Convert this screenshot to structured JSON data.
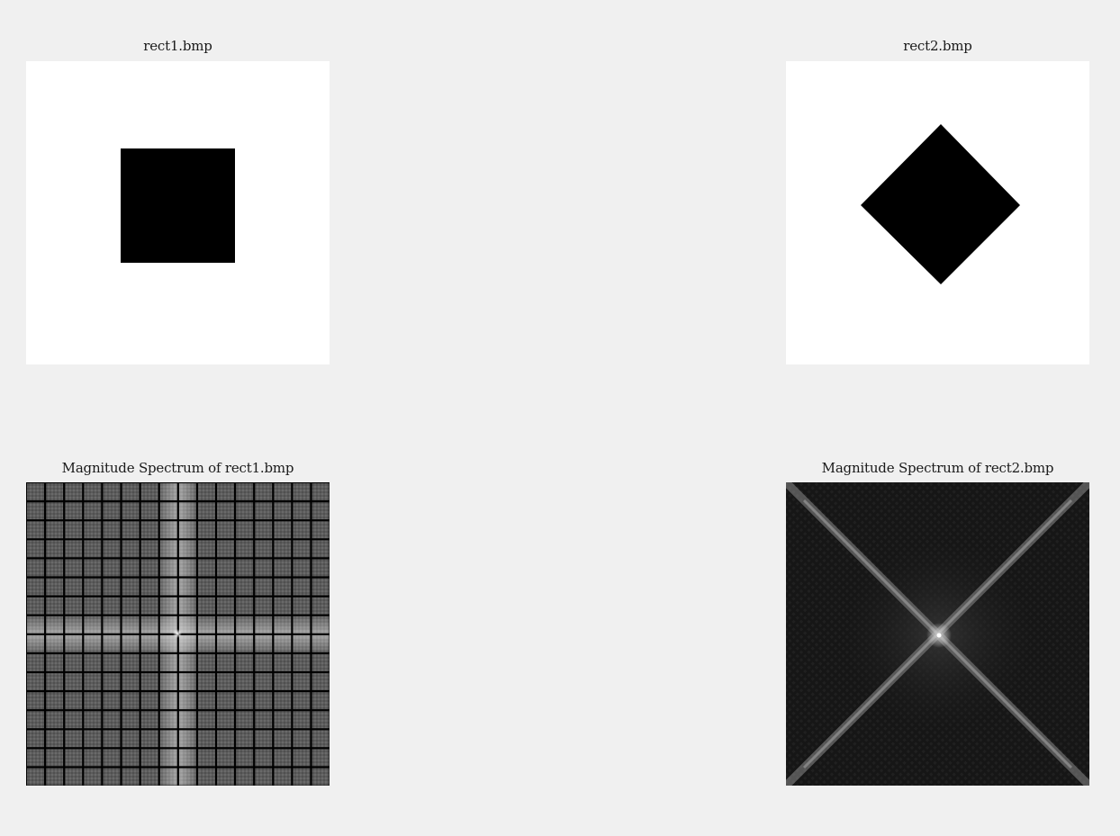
{
  "figure": {
    "background": "#f0f0f0",
    "panels": [
      {
        "id": "rect1",
        "title": "rect1.bmp",
        "content": "black-square-on-white"
      },
      {
        "id": "rect2",
        "title": "rect2.bmp",
        "content": "black-diamond-on-white"
      },
      {
        "id": "spectrum1",
        "title": "Magnitude Spectrum of rect1.bmp",
        "content": "grid-spectrum"
      },
      {
        "id": "spectrum2",
        "title": "Magnitude Spectrum of rect2.bmp",
        "content": "x-cross-spectrum"
      }
    ]
  },
  "colors": {
    "shape": "#000000",
    "image_background": "#ffffff",
    "spectrum1_base": "#5a5a5a",
    "spectrum2_base": "#141414",
    "spectrum_highlight": "#ffffff"
  }
}
